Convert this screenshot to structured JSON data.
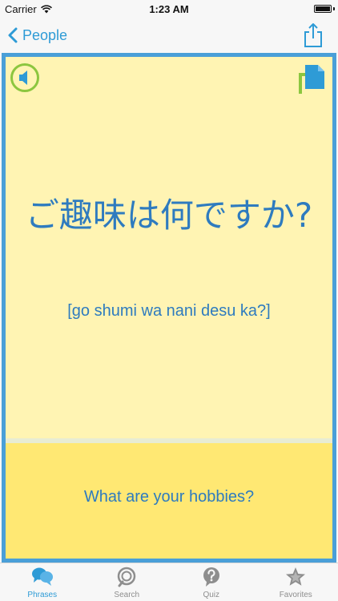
{
  "status_bar": {
    "carrier": "Carrier",
    "time": "1:23 AM"
  },
  "nav": {
    "back_label": "People"
  },
  "card": {
    "native_text": "ご趣味は何ですか?",
    "romanization": "[go shumi wa nani desu ka?]",
    "translation": "What are your hobbies?"
  },
  "tabs": [
    {
      "label": "Phrases",
      "icon": "speech-bubbles-icon",
      "active": true
    },
    {
      "label": "Search",
      "icon": "search-icon",
      "active": false
    },
    {
      "label": "Quiz",
      "icon": "quiz-icon",
      "active": false
    },
    {
      "label": "Favorites",
      "icon": "star-icon",
      "active": false
    }
  ],
  "colors": {
    "accent": "#2e9bd6",
    "card_border": "#4a9fd8",
    "card_top": "#fff4b3",
    "card_bottom": "#ffe873",
    "text_blue": "#2e7bbf",
    "sound_ring": "#8cc63f"
  }
}
